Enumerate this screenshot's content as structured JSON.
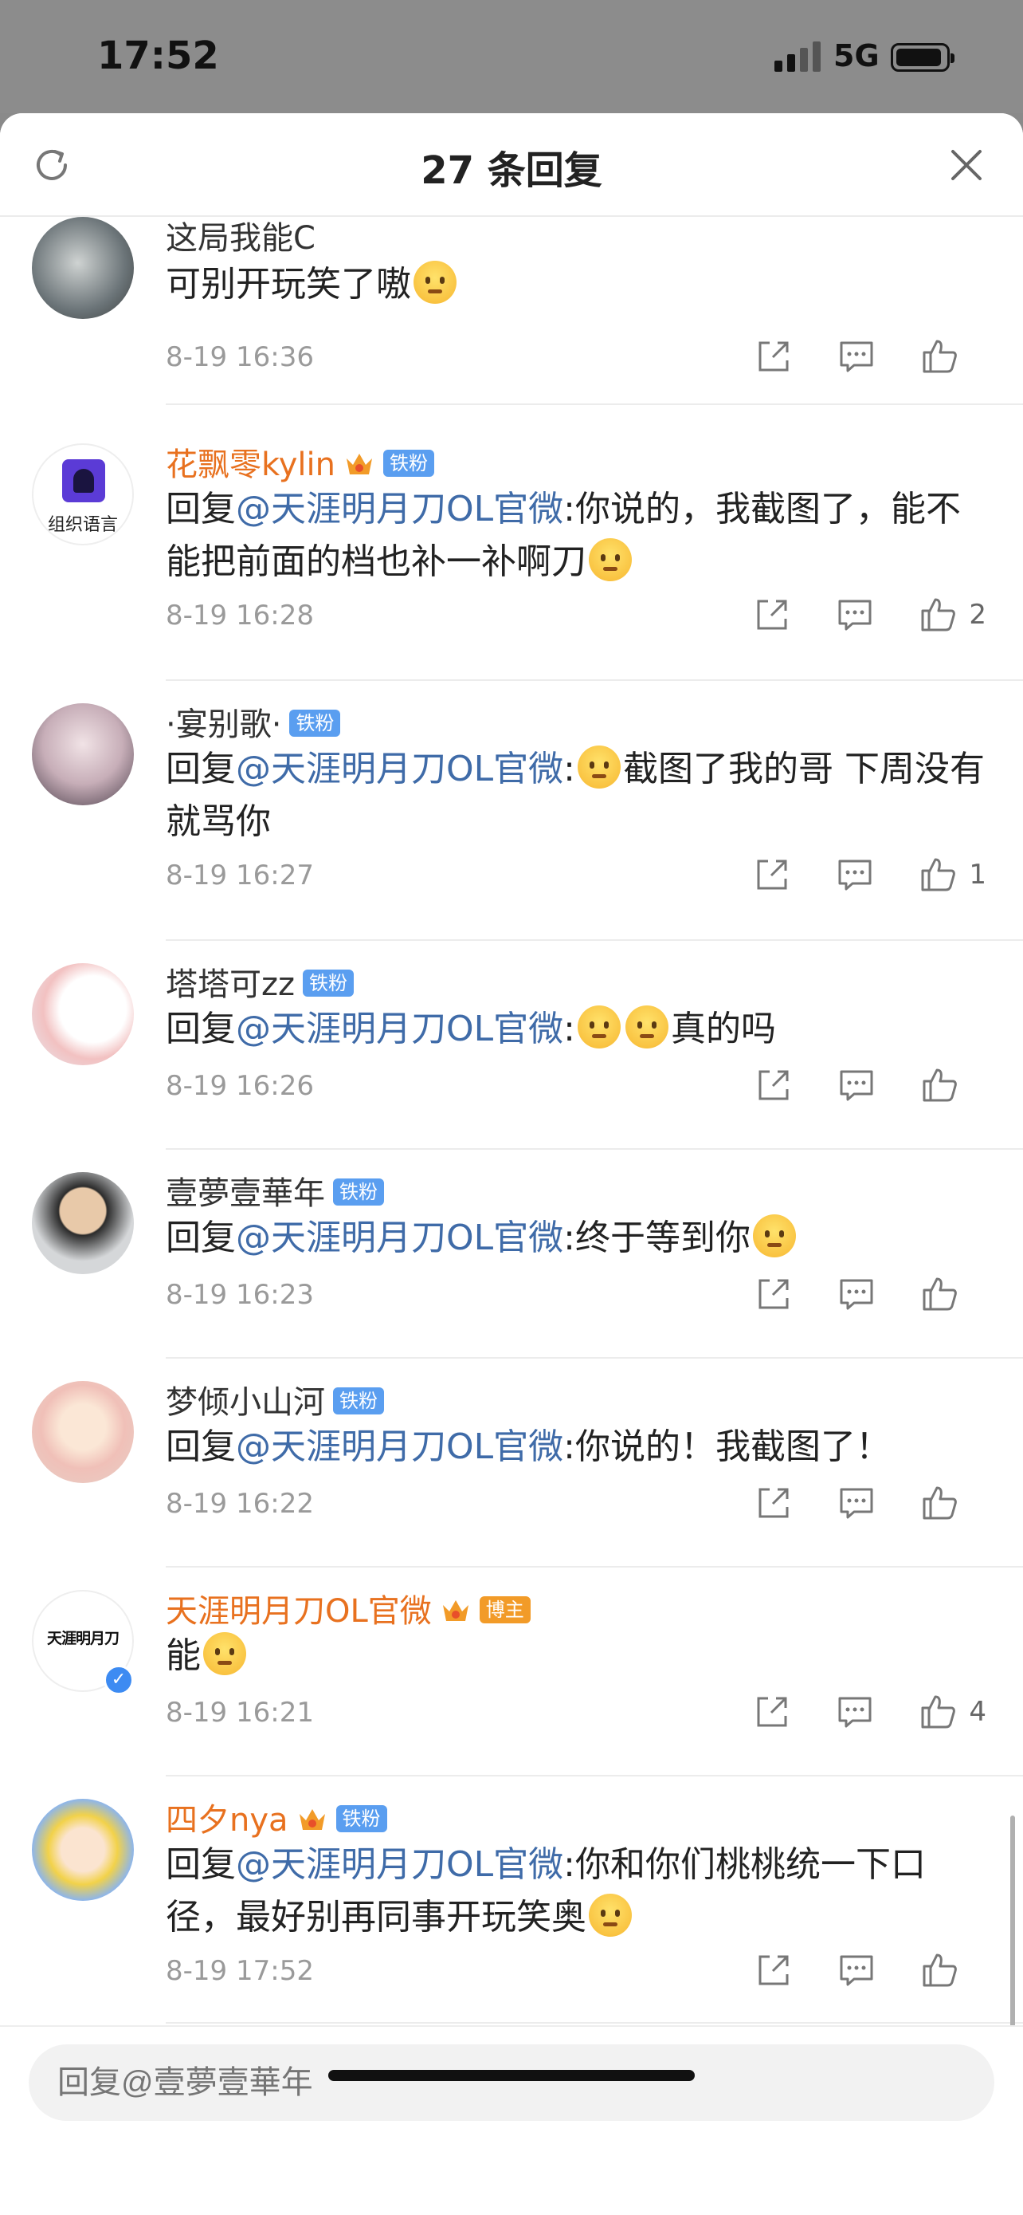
{
  "status_bar": {
    "time": "17:52",
    "network": "5G"
  },
  "header": {
    "title": "27 条回复"
  },
  "comments": [
    {
      "username": "这局我能C",
      "username_color": "gray",
      "badge": "",
      "text_mention": "",
      "text_before": "可别开玩笑了嗷",
      "text_after": "",
      "emojis_before": 0,
      "emojis_after": 1,
      "time": "8-19 16:36",
      "likes": ""
    },
    {
      "username": "花飘零kylin",
      "username_color": "orange",
      "badge": "铁粉",
      "crown": true,
      "reply_prefix": "回复",
      "text_mention": "@天涯明月刀OL官微",
      "text_before": ":你说的，我截图了，能不能把前面的档也补一补啊刀",
      "text_after": "",
      "emojis_after": 1,
      "time": "8-19 16:28",
      "likes": "2"
    },
    {
      "username": "·宴别歌·",
      "username_color": "gray",
      "badge": "铁粉",
      "reply_prefix": "回复",
      "text_mention": "@天涯明月刀OL官微",
      "text_before": ":",
      "text_after": "截图了我的哥 下周没有就骂你",
      "emojis_mid": 1,
      "time": "8-19 16:27",
      "likes": "1"
    },
    {
      "username": "塔塔可zz",
      "username_color": "gray",
      "badge": "铁粉",
      "reply_prefix": "回复",
      "text_mention": "@天涯明月刀OL官微",
      "text_before": ":",
      "text_after": "真的吗",
      "emojis_mid": 2,
      "time": "8-19 16:26",
      "likes": ""
    },
    {
      "username": "壹夢壹華年",
      "username_color": "gray",
      "badge": "铁粉",
      "reply_prefix": "回复",
      "text_mention": "@天涯明月刀OL官微",
      "text_before": ":终于等到你",
      "text_after": "",
      "emojis_after": 1,
      "time": "8-19 16:23",
      "likes": ""
    },
    {
      "username": "梦倾小山河",
      "username_color": "gray",
      "badge": "铁粉",
      "reply_prefix": "回复",
      "text_mention": "@天涯明月刀OL官微",
      "text_before": ":你说的！我截图了！",
      "text_after": "",
      "emojis_after": 0,
      "time": "8-19 16:22",
      "likes": ""
    },
    {
      "username": "天涯明月刀OL官微",
      "username_color": "orange",
      "badge": "博主",
      "badge_color": "orange",
      "crown": true,
      "reply_prefix": "",
      "text_mention": "",
      "text_before": "能",
      "text_after": "",
      "emojis_after": 1,
      "time": "8-19 16:21",
      "likes": "4",
      "verified": true,
      "avatar_text": "天涯明月刀"
    },
    {
      "username": "四夕nya",
      "username_color": "orange",
      "badge": "铁粉",
      "crown": true,
      "reply_prefix": "回复",
      "text_mention": "@天涯明月刀OL官微",
      "text_before": ":你和你们桃桃统一下口径，最好别再同事开玩笑奥",
      "text_after": "",
      "emojis_after": 1,
      "time": "8-19 17:52",
      "likes": ""
    }
  ],
  "avatar_texts": {
    "c2": "组织语言",
    "c7": "天涯明月刀"
  },
  "reply_bar": {
    "placeholder": "回复@壹夢壹華年"
  },
  "colors": {
    "accent_orange": "#e8711f",
    "mention_blue": "#3f6ba8",
    "badge_blue": "#5a9ef0"
  }
}
